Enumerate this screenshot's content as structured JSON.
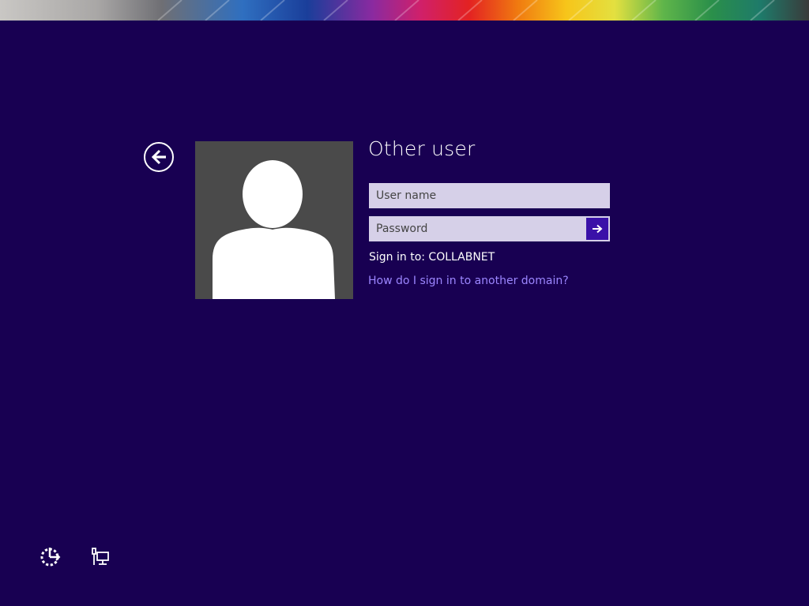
{
  "banner": {
    "icon": "color-stripes-banner"
  },
  "back_button": {
    "icon": "back-arrow-icon"
  },
  "avatar": {
    "icon": "user-silhouette-icon"
  },
  "login": {
    "title": "Other user",
    "username_placeholder": "User name",
    "password_placeholder": "Password",
    "submit_icon": "arrow-right-icon",
    "sign_in_to": "Sign in to: COLLABNET",
    "help_link": "How do I sign in to another domain?"
  },
  "bottom_bar": {
    "ease_of_access_icon": "ease-of-access-icon",
    "network_icon": "network-icon"
  },
  "colors": {
    "background": "#180052",
    "field": "#d6d0e8",
    "submit": "#3a11a8",
    "link": "#9c86ff",
    "avatar_bg": "#4a4a4a"
  }
}
